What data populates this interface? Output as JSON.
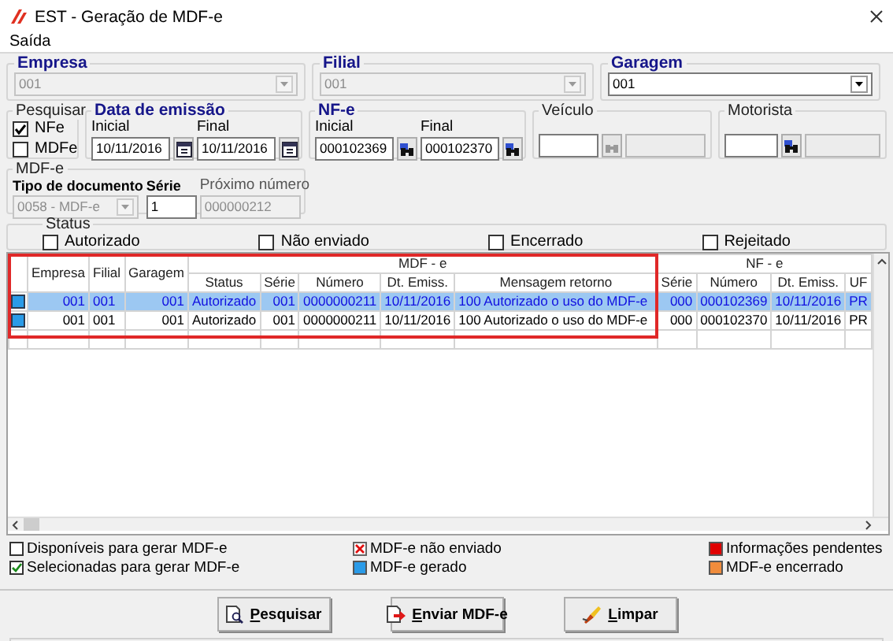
{
  "window": {
    "title": "EST - Geração de MDF-e"
  },
  "menu": [
    "Saída"
  ],
  "empresa": {
    "label": "Empresa",
    "value": "001",
    "disabled": true
  },
  "filial": {
    "label": "Filial",
    "value": "001",
    "disabled": true
  },
  "garagem": {
    "label": "Garagem",
    "value": "001",
    "disabled": false
  },
  "pesquisar": {
    "label": "Pesquisar",
    "options": [
      {
        "label": "NFe",
        "checked": true
      },
      {
        "label": "MDFe",
        "checked": false
      }
    ]
  },
  "data_emissao": {
    "label": "Data de emissão",
    "inicial_label": "Inicial",
    "inicial": "10/11/2016",
    "final_label": "Final",
    "final": "10/11/2016"
  },
  "nfe": {
    "label": "NF-e",
    "inicial_label": "Inicial",
    "inicial": "000102369",
    "final_label": "Final",
    "final": "000102370"
  },
  "veiculo": {
    "label": "Veículo",
    "search_disabled": true
  },
  "motorista": {
    "label": "Motorista",
    "search_disabled": false
  },
  "mdfe": {
    "label": "MDF-e",
    "tipo": {
      "label": "Tipo de documento",
      "value": "0058 - MDF-e",
      "disabled": true
    },
    "serie": {
      "label": "Série",
      "value": "1"
    },
    "proximo": {
      "label": "Próximo número",
      "value": "000000212",
      "disabled": true
    }
  },
  "status": {
    "label": "Status",
    "options": [
      {
        "label": "Autorizado",
        "checked": false
      },
      {
        "label": "Não enviado",
        "checked": false
      },
      {
        "label": "Encerrado",
        "checked": false
      },
      {
        "label": "Rejeitado",
        "checked": false
      }
    ]
  },
  "grid": {
    "fixed_columns": [
      "Empresa",
      "Filial",
      "Garagem"
    ],
    "groups": [
      {
        "label": "MDF - e",
        "columns": [
          "Status",
          "Série",
          "Número",
          "Dt. Emiss.",
          "Mensagem retorno"
        ]
      },
      {
        "label": "NF - e",
        "columns": [
          "Série",
          "Número",
          "Dt. Emiss.",
          "UF"
        ]
      }
    ],
    "rows": [
      {
        "selected": true,
        "color": "#2a9be8",
        "cells": [
          "001",
          "001",
          "001",
          "Autorizado",
          "001",
          "0000000211",
          "10/11/2016",
          "100 Autorizado o uso do MDF-e",
          "000",
          "000102369",
          "10/11/2016",
          "PR"
        ]
      },
      {
        "selected": false,
        "color": "#2a9be8",
        "cells": [
          "001",
          "001",
          "001",
          "Autorizado",
          "001",
          "0000000211",
          "10/11/2016",
          "100 Autorizado o uso do MDF-e",
          "000",
          "000102370",
          "10/11/2016",
          "PR"
        ]
      }
    ]
  },
  "legend": [
    {
      "kind": "unchecked",
      "label": "Disponíveis para gerar MDF-e"
    },
    {
      "kind": "checked",
      "label": "Selecionadas para gerar MDF-e"
    },
    {
      "kind": "cross",
      "label": "MDF-e não enviado"
    },
    {
      "kind": "swatch",
      "color": "#2a9be8",
      "label": "MDF-e gerado"
    },
    {
      "kind": "swatch",
      "color": "#e00000",
      "label": "Informações pendentes"
    },
    {
      "kind": "swatch",
      "color": "#f08c3c",
      "label": "MDF-e encerrado"
    }
  ],
  "buttons": [
    {
      "kind": "search",
      "label": "Pesquisar"
    },
    {
      "kind": "send",
      "label": "Enviar MDF-e"
    },
    {
      "kind": "clear",
      "label": "Limpar"
    }
  ]
}
